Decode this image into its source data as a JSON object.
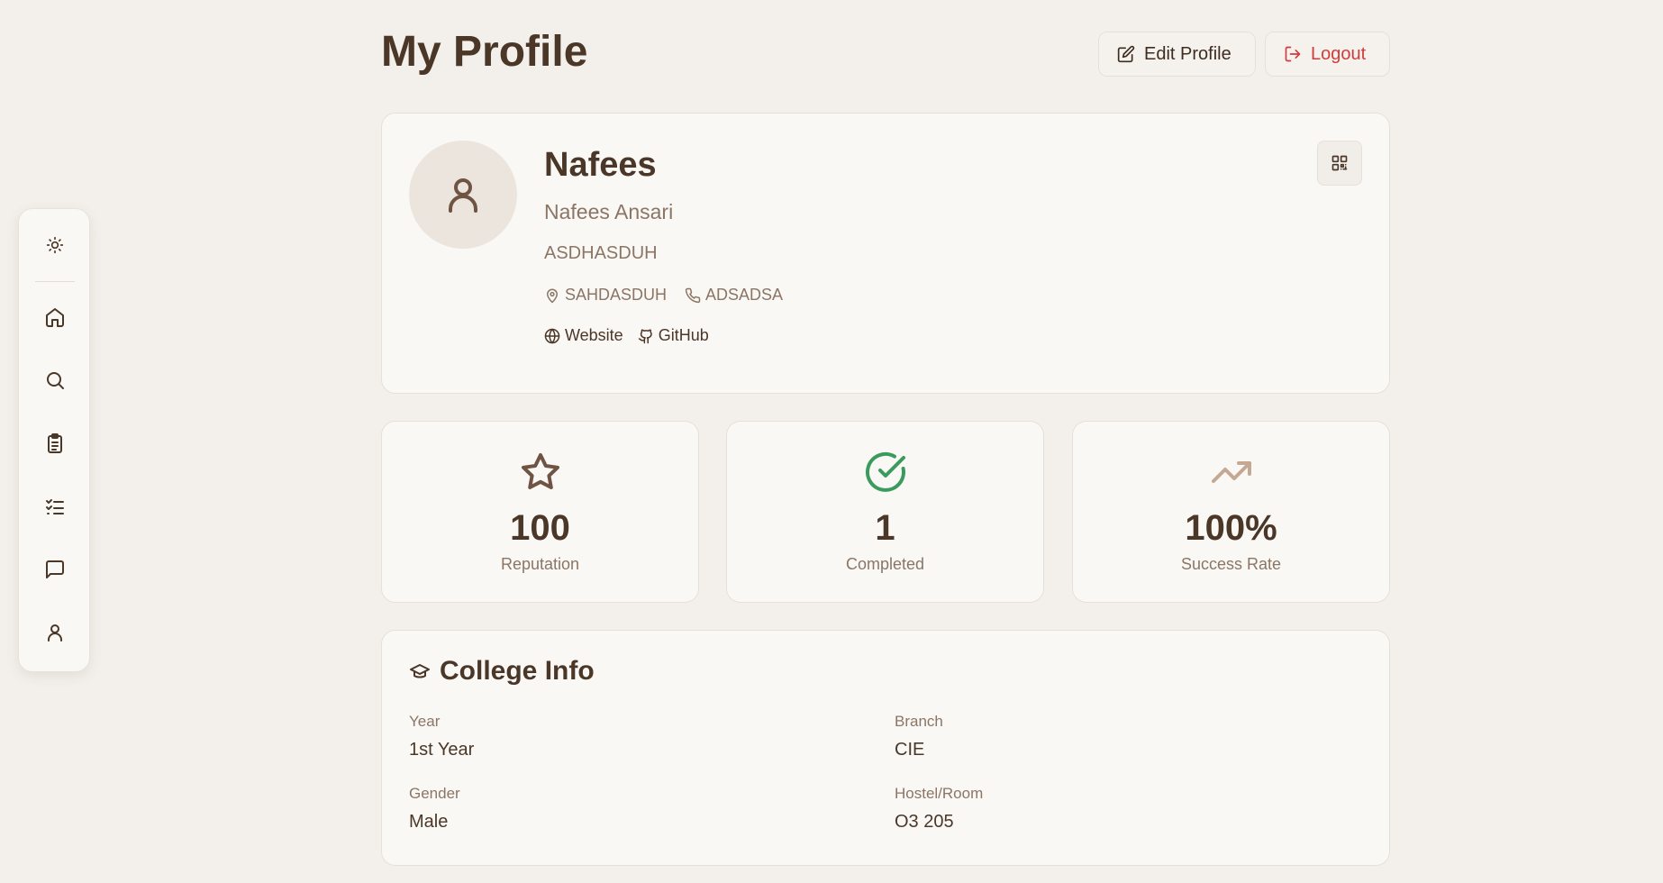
{
  "header": {
    "title": "My Profile",
    "edit_label": "Edit Profile",
    "logout_label": "Logout"
  },
  "sidebar": {
    "items": [
      {
        "icon": "sun-icon",
        "name": "theme-toggle"
      },
      {
        "icon": "home-icon",
        "name": "home"
      },
      {
        "icon": "search-icon",
        "name": "search"
      },
      {
        "icon": "clipboard-icon",
        "name": "tasks"
      },
      {
        "icon": "checklist-icon",
        "name": "checklist"
      },
      {
        "icon": "message-icon",
        "name": "messages"
      },
      {
        "icon": "user-icon",
        "name": "profile"
      }
    ]
  },
  "profile": {
    "name": "Nafees",
    "full_name": "Nafees Ansari",
    "handle": "ASDHASDUH",
    "location": "SAHDASDUH",
    "phone": "ADSADSA",
    "website_label": "Website",
    "github_label": "GitHub"
  },
  "stats": [
    {
      "value": "100",
      "label": "Reputation",
      "icon": "star-icon",
      "color": "#6f5443"
    },
    {
      "value": "1",
      "label": "Completed",
      "icon": "check-circle-icon",
      "color": "#3a9b5c"
    },
    {
      "value": "100%",
      "label": "Success Rate",
      "icon": "trending-up-icon",
      "color": "#c4a894"
    }
  ],
  "college": {
    "title": "College Info",
    "year_label": "Year",
    "year_value": "1st Year",
    "branch_label": "Branch",
    "branch_value": "CIE",
    "gender_label": "Gender",
    "gender_value": "Male",
    "hostel_label": "Hostel/Room",
    "hostel_value": "O3 205"
  },
  "colors": {
    "background": "#f3f0eb",
    "card": "#faf8f5",
    "text": "#4a3728",
    "muted": "#8b7565",
    "danger": "#d23b3b",
    "success": "#3a9b5c"
  }
}
